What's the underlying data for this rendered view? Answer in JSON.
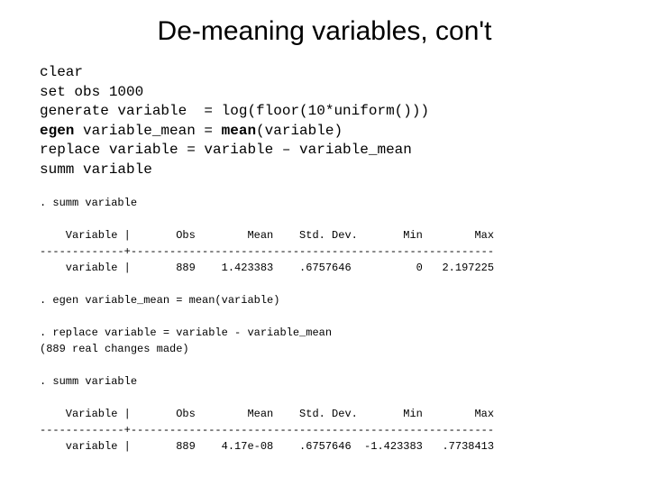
{
  "title": "De-meaning variables, con't",
  "code": {
    "l1": "clear",
    "l2": "set obs 1000",
    "l3": "generate variable  = log(floor(10*uniform()))",
    "l4a": "egen",
    "l4b": " variable_mean = ",
    "l4c": "mean",
    "l4d": "(variable)",
    "l5": "replace variable = variable – variable_mean",
    "l6": "summ variable"
  },
  "out": {
    "l1": ". summ variable",
    "blank": "",
    "hdr": "    Variable |       Obs        Mean    Std. Dev.       Min        Max",
    "sep": "-------------+--------------------------------------------------------",
    "r1": "    variable |       889    1.423383    .6757646          0   2.197225",
    "l2": ". egen variable_mean = mean(variable)",
    "l3": ". replace variable = variable - variable_mean",
    "l4": "(889 real changes made)",
    "l5": ". summ variable",
    "r2": "    variable |       889    4.17e-08    .6757646  -1.423383   .7738413"
  }
}
